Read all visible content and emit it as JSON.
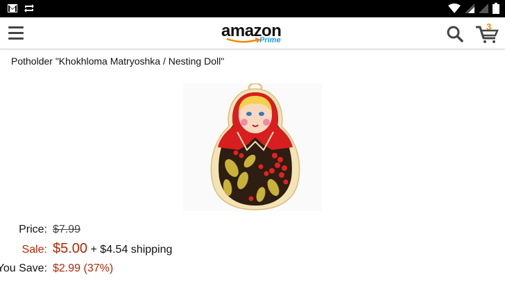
{
  "status_bar": {
    "left_icons": [
      "gmail-icon",
      "sync-icon"
    ],
    "right_icons": [
      "wifi-icon",
      "signal-icon",
      "signal-icon",
      "battery-icon"
    ]
  },
  "app_bar": {
    "logo_text": "amazon",
    "logo_sub": "Prime",
    "cart_count": "3"
  },
  "product": {
    "title": "Potholder \"Khokhloma Matryoshka / Nesting Doll\"",
    "price_label": "Price:",
    "price_value": "$7.99",
    "sale_label": "Sale:",
    "sale_value": "$5.00",
    "shipping": "+ $4.54 shipping",
    "save_label": "You Save:",
    "save_value": "$2.99 (37%)"
  },
  "colors": {
    "accent": "#f08804",
    "sale": "#b12704",
    "prime": "#1a98ff"
  }
}
